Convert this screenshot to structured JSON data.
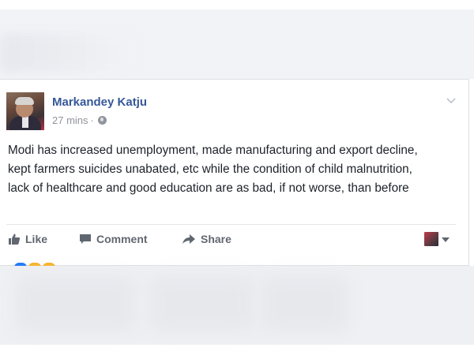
{
  "post": {
    "author_name": "Markandey Katju",
    "timestamp": "27 mins",
    "separator": "·",
    "privacy_icon": "globe-icon",
    "menu_icon": "chevron-down-icon",
    "body": "Modi has increased unemployment, made manufacturing and export decline, kept farmers suicides unabated, etc while the condition of child malnutrition, lack of healthcare and good education are as bad, if not worse, than before"
  },
  "actions": {
    "like_label": "Like",
    "comment_label": "Comment",
    "share_label": "Share"
  },
  "colors": {
    "author_link": "#365899",
    "meta_gray": "#90949c",
    "action_gray": "#616770",
    "reaction_blue": "#2078f4",
    "reaction_yellow": "#f7b125"
  }
}
